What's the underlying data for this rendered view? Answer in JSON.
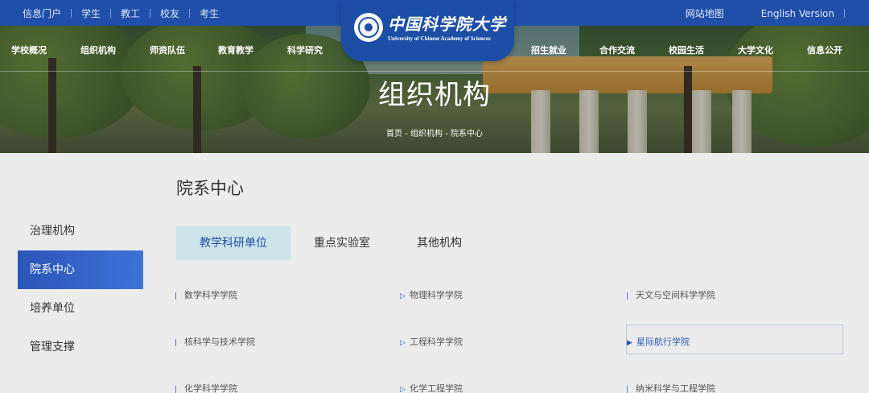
{
  "topbar": {
    "left_links": [
      "信息门户",
      "学生",
      "教工",
      "校友",
      "考生"
    ],
    "sitemap": "网站地图",
    "english": "English Version"
  },
  "logo": {
    "cn": "中国科学院大学",
    "en": "University of Chinese Academy of Sciences"
  },
  "nav": {
    "items": [
      "学校概况",
      "组织机构",
      "师资队伍",
      "教育教学",
      "科学研究",
      "招生就业",
      "合作交流",
      "校园生活",
      "大学文化",
      "信息公开"
    ]
  },
  "hero": {
    "title": "组织机构",
    "breadcrumb": "首页 - 组织机构 - 院系中心"
  },
  "page": {
    "title": "院系中心"
  },
  "sidebar": {
    "items": [
      {
        "label": "治理机构",
        "active": false
      },
      {
        "label": "院系中心",
        "active": true
      },
      {
        "label": "培养单位",
        "active": false
      },
      {
        "label": "管理支撑",
        "active": false
      }
    ]
  },
  "tabs": [
    {
      "label": "教学科研单位",
      "active": true
    },
    {
      "label": "重点实验室",
      "active": false
    },
    {
      "label": "其他机构",
      "active": false
    }
  ],
  "links": {
    "rows": [
      [
        "数学科学学院",
        "物理科学学院",
        "天文与空间科学学院"
      ],
      [
        "核科学与技术学院",
        "工程科学学院",
        "星际航行学院"
      ],
      [
        "化学科学学院",
        "化学工程学院",
        "纳米科学与工程学院"
      ]
    ],
    "highlighted": "星际航行学院"
  },
  "colors": {
    "primary": "#1f4fa8",
    "active_tab_bg": "#cce4ea",
    "page_bg": "#ececec"
  }
}
